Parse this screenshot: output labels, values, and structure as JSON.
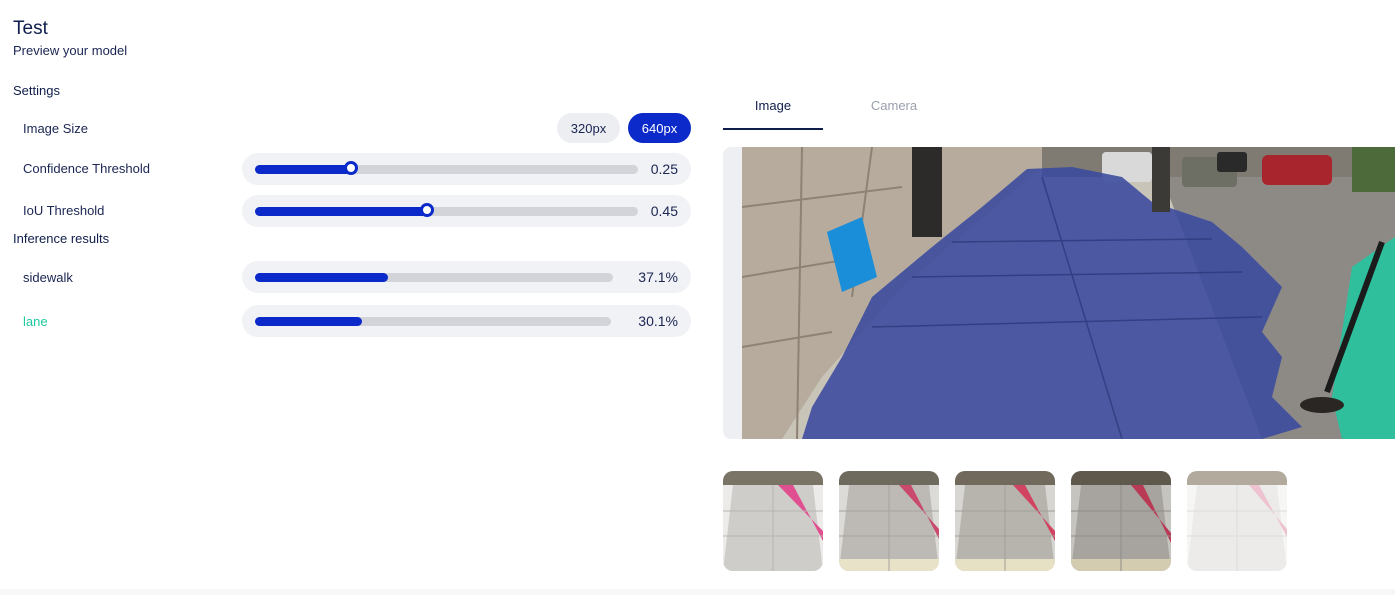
{
  "header": {
    "title": "Test",
    "subtitle": "Preview your model"
  },
  "settings": {
    "heading": "Settings",
    "image_size": {
      "label": "Image Size",
      "options": [
        "320px",
        "640px"
      ],
      "selected": "640px"
    },
    "confidence": {
      "label": "Confidence Threshold",
      "value": 0.25,
      "display": "0.25"
    },
    "iou": {
      "label": "IoU Threshold",
      "value": 0.45,
      "display": "0.45"
    }
  },
  "inference": {
    "heading": "Inference results",
    "results": [
      {
        "label": "sidewalk",
        "percent": 37.1,
        "display": "37.1%",
        "color": "#1a2552"
      },
      {
        "label": "lane",
        "percent": 30.1,
        "display": "30.1%",
        "color": "#1fc8a0"
      }
    ]
  },
  "tabs": [
    {
      "label": "Image",
      "active": true
    },
    {
      "label": "Camera",
      "active": false
    }
  ],
  "colors": {
    "accent": "#0b2ac9",
    "mask_sidewalk": "#3a4a9e",
    "mask_lane": "#1fc8a0"
  }
}
